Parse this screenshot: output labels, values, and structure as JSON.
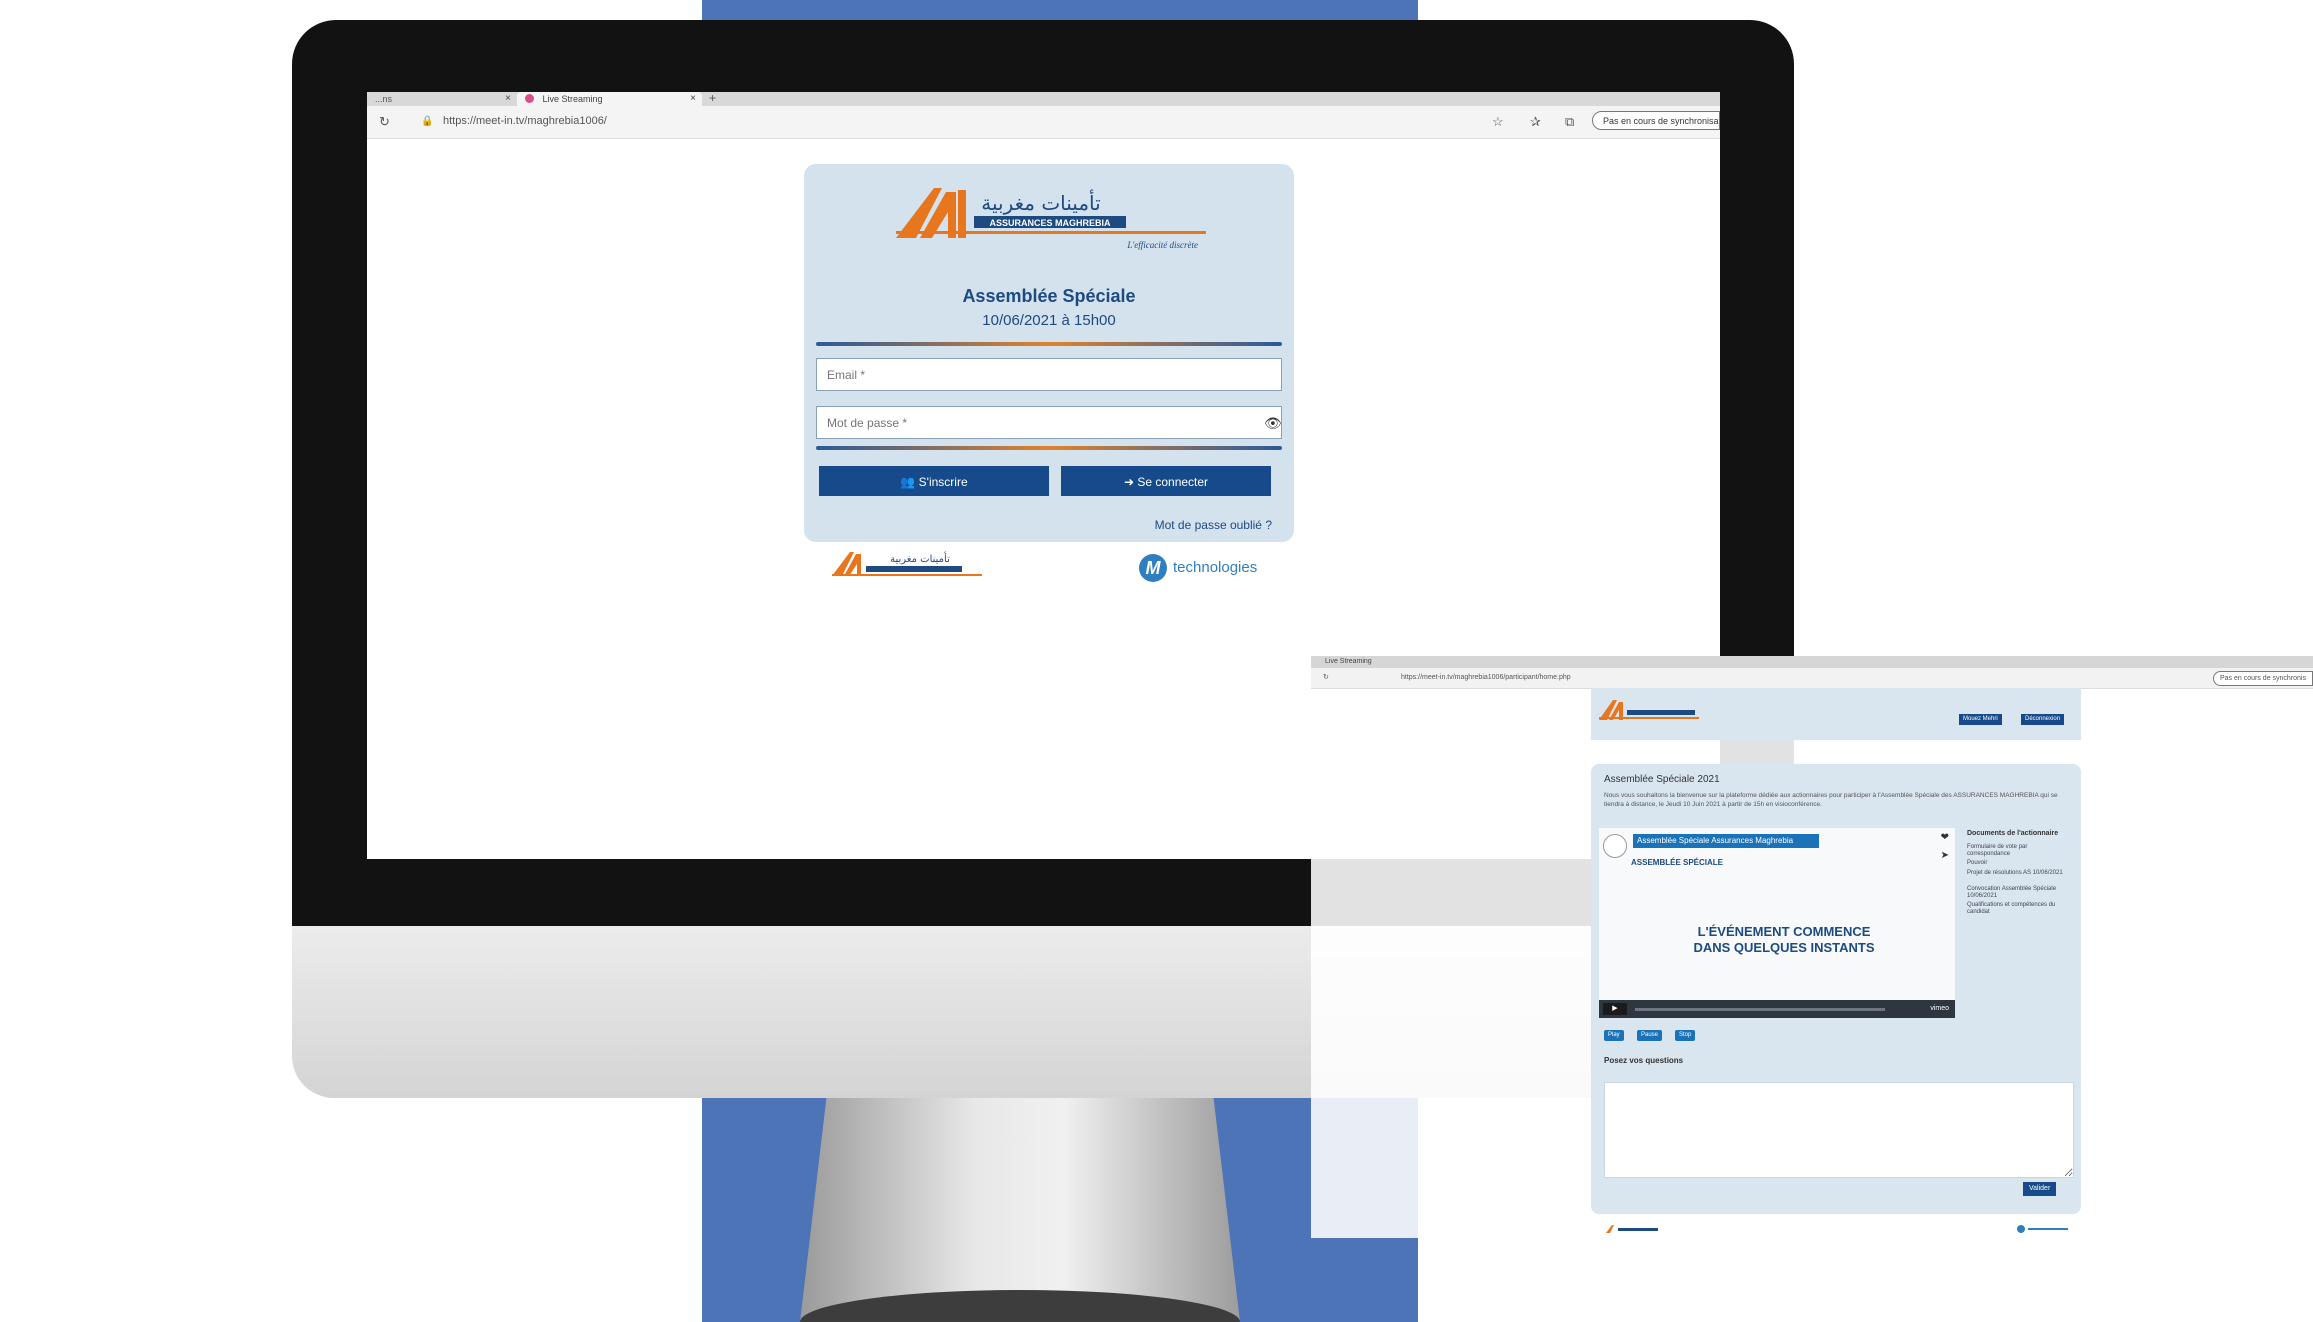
{
  "browser": {
    "tab_inactive": "...ns",
    "tab_active": "Live Streaming",
    "tab_close": "×",
    "tab_new": "+",
    "url": "https://meet-in.tv/maghrebia1006/",
    "sync_button": "Pas en cours de synchronisation"
  },
  "login": {
    "title": "Assemblée Spéciale",
    "date": "10/06/2021 à 15h00",
    "email_placeholder": "Email *",
    "password_placeholder": "Mot de passe *",
    "signup_label": "S'inscrire",
    "login_label": "Se connecter",
    "forgot_password": "Mot de passe oublié ?"
  },
  "logo": {
    "arabic": "تأمينات مغربية",
    "brand": "ASSURANCES MAGHREBIA",
    "slogan": "L'efficacité discrète"
  },
  "partner": {
    "name": "technologies",
    "mark": "M"
  },
  "overlay": {
    "tab": "Live Streaming",
    "url": "https://meet-in.tv/maghrebia1006/participant/home.php",
    "sync_button": "Pas en cours de synchronis",
    "btn_user": "Mouez Mehri",
    "btn_logout": "Déconnexion",
    "title": "Assemblée Spéciale 2021",
    "description": "Nous vous souhaitons la bienvenue sur la plateforme dédiée aux actionnaires pour participer à l'Assemblée Spéciale des ASSURANCES MAGHREBIA qui se tiendra à distance, le Jeudi 10 Juin 2021 à partir de 15h en visioconférence.",
    "video_title": "Assemblée Spéciale Assurances Maghrebia",
    "video_subtitle": "ASSEMBLÉE SPÉCIALE",
    "video_message_line1": "L'ÉVÉNEMENT COMMENCE",
    "video_message_line2": "DANS QUELQUES INSTANTS",
    "vimeo": "vimeo",
    "docs_title": "Documents de l'actionnaire",
    "docs": [
      "Formulaire de vote par correspondance",
      "Pouvoir",
      "Projet de résolutions AS 10/06/2021",
      "Convocation Assemblée Spéciale 10/06/2021",
      "Qualifications et compétences du candidat"
    ],
    "pills": [
      "Play",
      "Pause",
      "Stop"
    ],
    "questions": "Posez vos questions",
    "submit": "Valider"
  },
  "colors": {
    "brand_blue": "#174a8a",
    "brand_orange": "#e8761e",
    "card_bg": "#d4e2ee",
    "backdrop_blue": "#4c74b6"
  }
}
